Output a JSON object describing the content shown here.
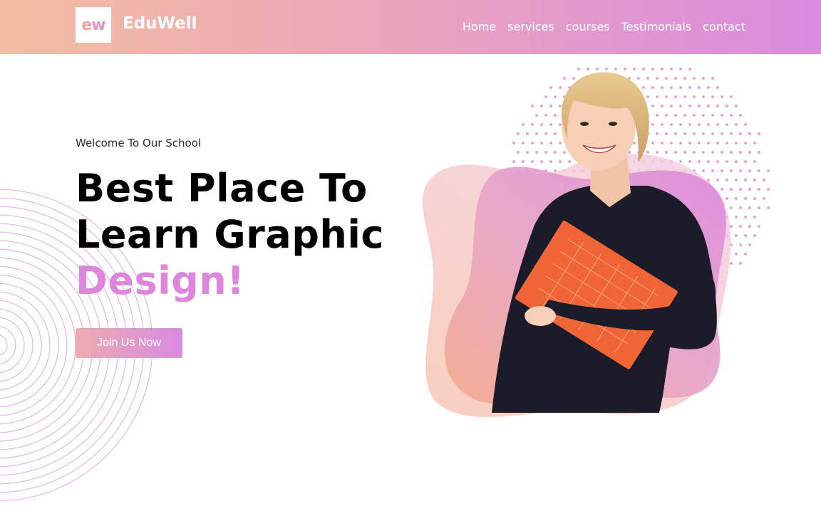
{
  "brand": {
    "logo_mark": "ew",
    "name": "EduWell"
  },
  "nav": {
    "items": [
      {
        "label": "Home"
      },
      {
        "label": "services"
      },
      {
        "label": "courses"
      },
      {
        "label": "Testimonials"
      },
      {
        "label": "contact"
      }
    ]
  },
  "hero": {
    "eyebrow": "Welcome To Our School",
    "title_line1": "Best Place To",
    "title_line2": "Learn Graphic",
    "title_accent": "Design!",
    "cta_label": "Join Us Now"
  },
  "colors": {
    "header_start": "#f3bca1",
    "header_end": "#d98ae0",
    "accent": "#dd86dc"
  }
}
